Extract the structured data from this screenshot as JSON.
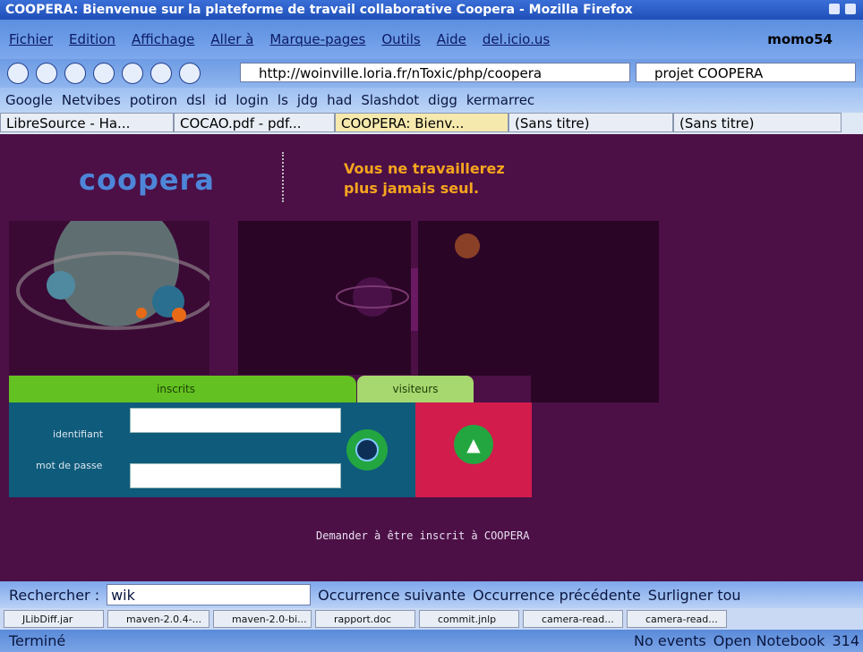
{
  "window": {
    "title": "COOPERA: Bienvenue sur la plateforme de travail collaborative Coopera - Mozilla Firefox"
  },
  "menu": [
    "Fichier",
    "Edition",
    "Affichage",
    "Aller à",
    "Marque-pages",
    "Outils",
    "Aide",
    "del.icio.us"
  ],
  "user": "momo54",
  "nav": {
    "url": "http://woinville.loria.fr/nToxic/php/coopera",
    "search_value": "projet COOPERA"
  },
  "bookmarks": [
    "Google",
    "Netvibes",
    "potiron",
    "dsl",
    "id",
    "login",
    "ls",
    "jdg",
    "had",
    "Slashdot",
    "digg",
    "kermarrec"
  ],
  "tabs": [
    {
      "label": "LibreSource - Ha..."
    },
    {
      "label": "COCAO.pdf - pdf..."
    },
    {
      "label": "COOPERA: Bienv..."
    },
    {
      "label": "(Sans titre)"
    },
    {
      "label": "(Sans titre)"
    }
  ],
  "page": {
    "logo": "coopera",
    "tagline_line1": "Vous ne travaillerez",
    "tagline_line2": "plus jamais seul.",
    "tab_inscrits": "inscrits",
    "tab_visiteurs": "visiteurs",
    "label_identifiant": "identifiant",
    "label_mot_de_passe": "mot de passe",
    "identifiant_value": "",
    "password_value": "",
    "demander_link": "Demander à être inscrit à COOPERA"
  },
  "findbar": {
    "label": "Rechercher :",
    "value": "wik",
    "next": "Occurrence suivante",
    "prev": "Occurrence précédente",
    "highlight": "Surligner tou"
  },
  "taskbar": [
    "JLibDiff.jar",
    "maven-2.0.4-...",
    "maven-2.0-bi...",
    "rapport.doc",
    "commit.jnlp",
    "camera-read...",
    "camera-read..."
  ],
  "status": {
    "text": "Terminé",
    "events": "No events",
    "notebook": "Open Notebook",
    "mail_count": "314"
  }
}
